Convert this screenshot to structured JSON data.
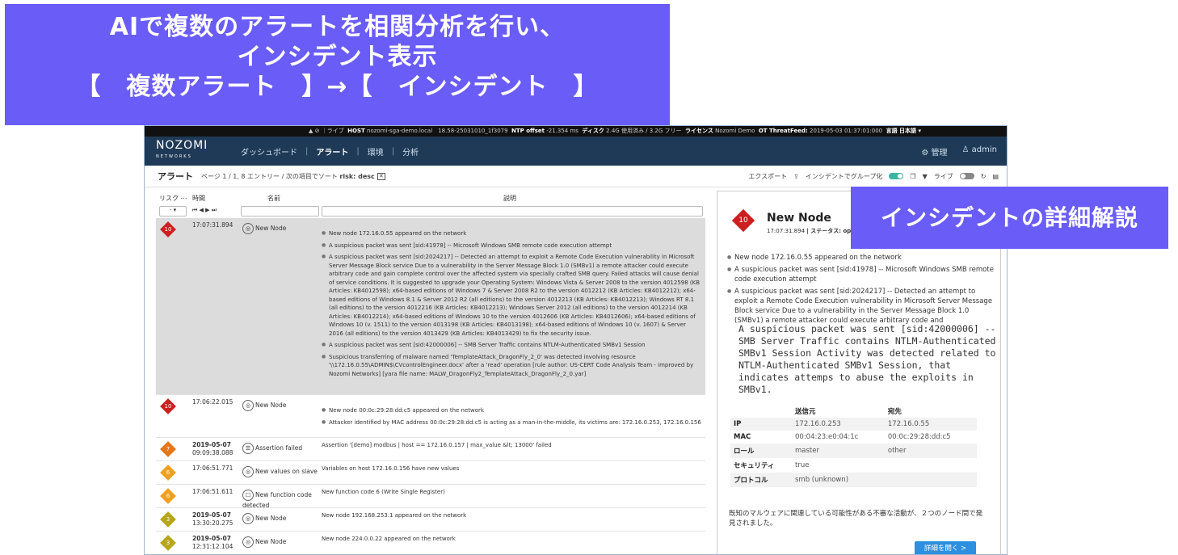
{
  "banner": {
    "line1": "AIで複数のアラートを相関分析を行い、",
    "line2": "インシデント表示",
    "line3": "【　複数アラート　】→【　インシデント　】"
  },
  "callout": "インシデントの詳細解説",
  "topstrip": {
    "text1": "▲ ⊘ ｜ライブ",
    "host_label": "HOST",
    "host_value": "nozomi-sga-demo.local　18.58-25031010_1f3079",
    "ntp_label": "NTP offset",
    "ntp_value": "-21.354 ms",
    "disk_label": "ディスク",
    "disk_value": "2.4G 使用済み / 3.2G フリー",
    "license_label": "ライセンス",
    "license_value": "Nozomi Demo",
    "ot_label": "OT ThreatFeed:",
    "ot_value": "2019-05-03 01:37:01:000",
    "lang": "言語 日本語 ▾"
  },
  "nav": {
    "logo": "NOZOMI",
    "logo_sub": "NETWORKS",
    "dashboard": "ダッシュボード",
    "alerts": "アラート",
    "env": "環境",
    "analysis": "分析",
    "admin_mgmt": "⚙ 管理",
    "user": "♙ admin"
  },
  "subbar": {
    "title": "アラート",
    "paging": "ページ 1 / 1, 8 エントリー / 次の項目でソート",
    "sort": "risk: desc",
    "export": "エクスポート",
    "group": "インシデントでグループ化",
    "live": "ライブ"
  },
  "columns": {
    "risk": "リスク ⋯",
    "time": "時間",
    "name": "名前",
    "desc": "説明",
    "nav_arrows": "⏮ ◀ ▶ ⏭",
    "risk_filter": "- ▾"
  },
  "rows": [
    {
      "risk": "10",
      "color": "#cc1f1f",
      "date": "",
      "time": "17:07:31.894",
      "name": "New Node",
      "desc": [
        "New node 172.16.0.55 appeared on the network",
        "A suspicious packet was sent [sid:41978] -- Microsoft Windows SMB remote code execution attempt",
        "A suspicious packet was sent [sid:2024217] -- Detected an attempt to exploit a Remote Code Execution vulnerability in Microsoft Server Message Block service Due to a vulnerability in the Server Message Block 1.0 (SMBv1) a remote attacker could execute arbitrary code and gain complete control over the affected system via specially crafted SMB query. Failed attacks will cause denial of service conditions. It is suggested to upgrade your Operating System: Windows Vista & Server 2008 to the version 4012598 (KB Articles: KB4012598); x64-based editions of Windows 7 & Server 2008 R2 to the version 4012212 (KB Articles: KB4012212); x64-based editions of Windows 8.1 & Server 2012 R2 (all editions) to the version 4012213 (KB Articles: KB4012213); Windows RT 8.1 (all editions) to the version 4012216 (KB Articles: KB4012213); Windows Server 2012 (all editions) to the version 4012214 (KB Articles: KB4012214); x64-based editions of Windows 10 to the version 4012606 (KB Articles: KB4012606); x64-based editions of Windows 10 (v. 1511) to the version 4013198 (KB Articles: KB4013198); x64-based editions of Windows 10 (v. 1607) & Server 2016 (all editions) to the version 4013429 (KB Articles: KB4013429) to fix the security issue.",
        "A suspicious packet was sent [sid:42000006] -- SMB Server Traffic contains NTLM-Authenticated SMBv1 Session",
        "Suspicious transferring of malware named 'TemplateAttack_DragonFly_2_0' was detected involving resource '\\\\172.16.0.55\\ADMIN$\\CVcontrolEngineer.docx' after a 'read' operation [rule author: US-CERT Code Analysis Team - improved by Nozomi Networks] [yara file name: MALW_DragonFly2_TemplateAttack_DragonFly_2_0.yar]"
      ]
    },
    {
      "risk": "10",
      "color": "#cc1f1f",
      "date": "",
      "time": "17:06:22.015",
      "name": "New Node",
      "desc": [
        "New node 00:0c:29:28:dd:c5 appeared on the network",
        "Attacker identified by MAC address 00:0c:29:28:dd:c5 is acting as a man-in-the-middle, its victims are: 172.16.0.253, 172.16.0.156"
      ]
    },
    {
      "risk": "7",
      "color": "#e6761a",
      "date": "2019-05-07",
      "time": "09:09:38.088",
      "name": "Assertion failed",
      "desc": [
        "Assertion '[demo] modbus | host == 172.16.0.157 | max_value &lt; 13000' failed"
      ]
    },
    {
      "risk": "6",
      "color": "#f0a020",
      "date": "",
      "time": "17:06:51.771",
      "name": "New values on slave",
      "desc": [
        "Variables on host 172.16.0.156 have new values"
      ]
    },
    {
      "risk": "6",
      "color": "#f0a020",
      "date": "",
      "time": "17:06:51.611",
      "name": "New function code detected",
      "desc": [
        "New function code 6 (Write Single Register)"
      ]
    },
    {
      "risk": "3",
      "color": "#b5a61a",
      "date": "2019-05-07",
      "time": "13:30:20.275",
      "name": "New Node",
      "desc": [
        "New node 192.168.253.1 appeared on the network"
      ]
    },
    {
      "risk": "3",
      "color": "#b5a61a",
      "date": "2019-05-07",
      "time": "12:31:12.104",
      "name": "New Node",
      "desc": [
        "New node 224.0.0.22 appeared on the network"
      ]
    }
  ],
  "panel": {
    "risk": "10",
    "title": "New Node",
    "subtitle_time": "17:07:31.894",
    "subtitle_status": "| ステータス: ope",
    "items": [
      "New node 172.16.0.55 appeared on the network",
      "A suspicious packet was sent [sid:41978] -- Microsoft Windows SMB remote code execution attempt",
      "A suspicious packet was sent [sid:2024217] -- Detected an attempt to exploit a Remote Code Execution vulnerability in Microsoft Server Message Block service Due to a vulnerability in the Server Message Block 1.0 (SMBv1) a remote attacker could execute arbitrary code and"
    ],
    "overlay": "A suspicious packet was sent [sid:42000006] -- SMB Server Traffic contains NTLM-Authenticated SMBv1 Session Activity was detected related to NTLM-Authenticated SMBv1 Session, that indicates attemps to abuse the exploits in SMBv1.",
    "table": {
      "h_src": "送信元",
      "h_dst": "宛先",
      "rows": [
        {
          "k": "IP",
          "src": "172.16.0.253",
          "dst": "172.16.0.55"
        },
        {
          "k": "MAC",
          "src": "00:04:23:e0:04:1c",
          "dst": "00:0c:29:28:dd:c5"
        },
        {
          "k": "ロール",
          "src": "master",
          "dst": "other"
        },
        {
          "k": "セキュリティ",
          "src": "true",
          "dst": ""
        },
        {
          "k": "プロトコル",
          "src": "smb (unknown)",
          "dst": ""
        }
      ]
    },
    "note": "既知のマルウェアに関連している可能性がある不審な活動が、２つのノード間で発見されました。",
    "button": "詳細を開く >"
  },
  "colors": {
    "banner": "#6a5cf7",
    "nav": "#1f3a57",
    "accent": "#2d8fe0",
    "critical": "#cc1f1f"
  },
  "icons": [
    "eye-icon",
    "list-check-icon",
    "square-icon",
    "gear-icon",
    "user-icon",
    "export-icon",
    "filter-icon",
    "refresh-icon",
    "columns-icon"
  ]
}
